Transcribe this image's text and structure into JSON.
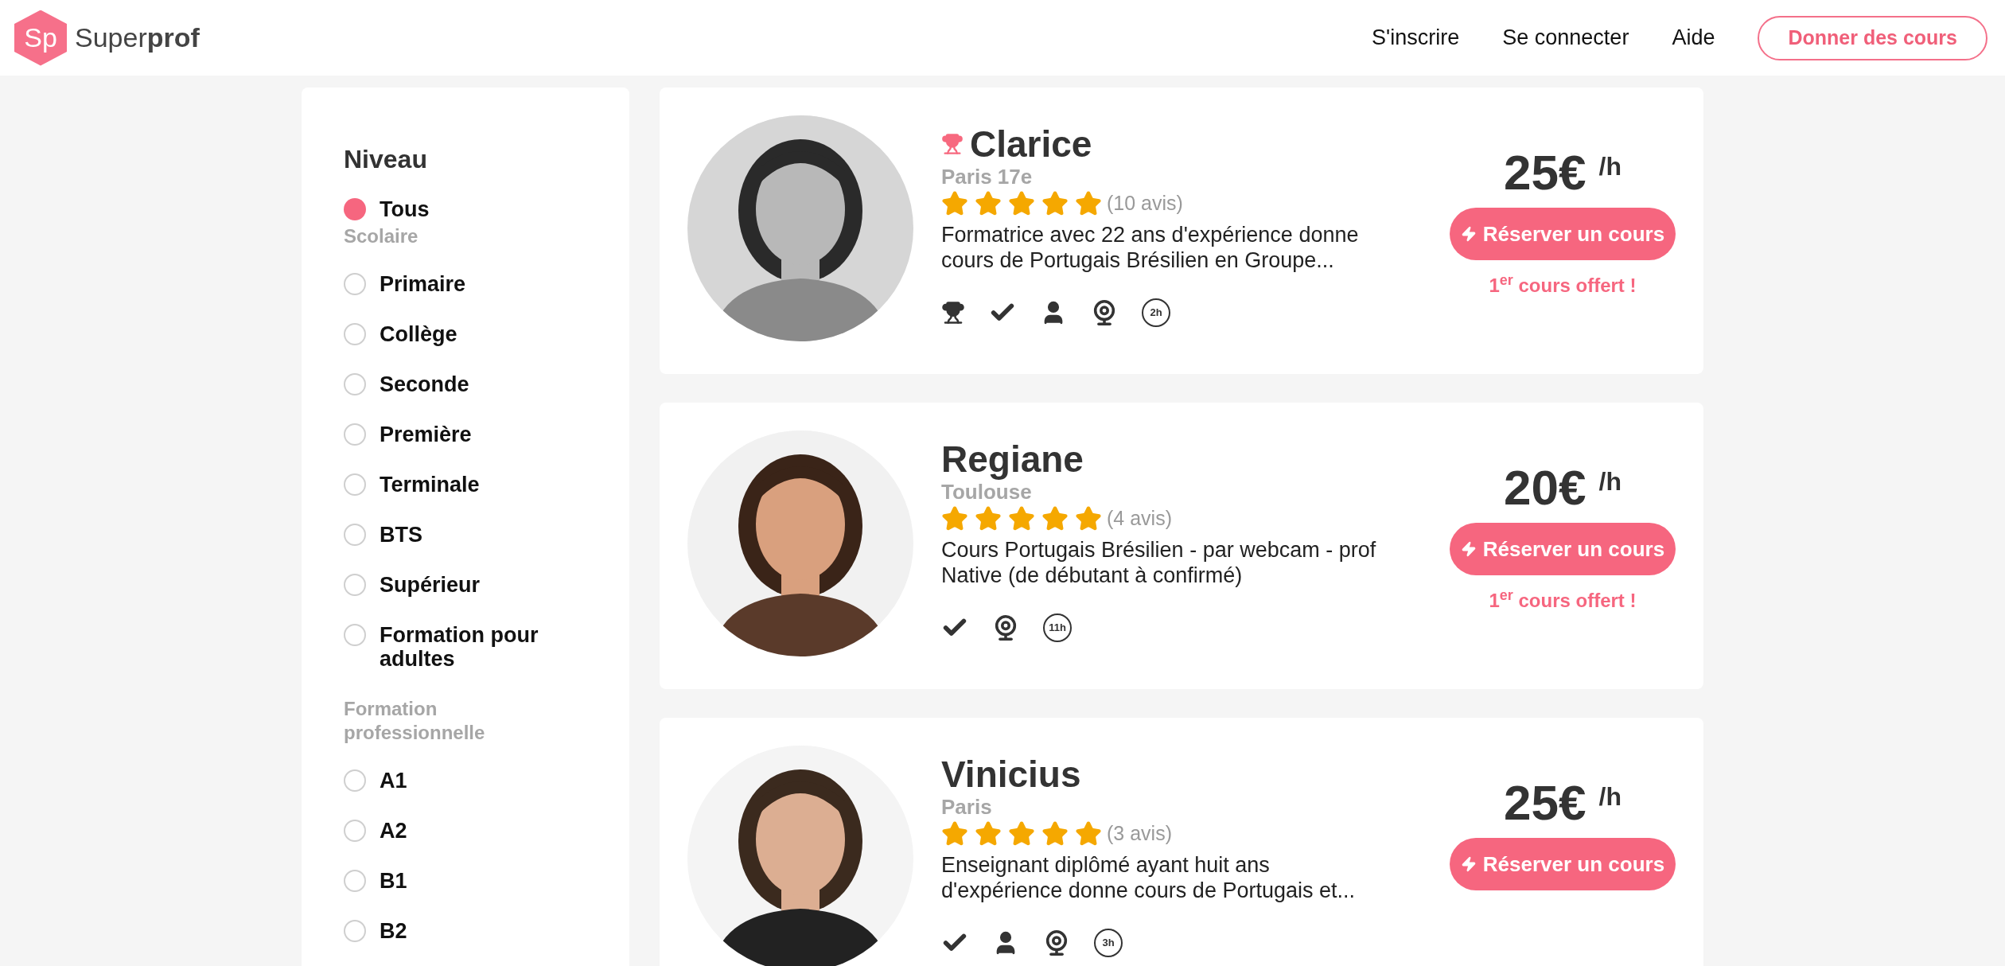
{
  "header": {
    "logo_mark": "Sp",
    "logo_text": "Super**prof**",
    "nav": [
      "S'inscrire",
      "Se connecter",
      "Aide"
    ],
    "cta": "Donner des cours"
  },
  "sidebar": {
    "title": "Niveau",
    "items": [
      {
        "kind": "option",
        "label": "Tous",
        "selected": true
      },
      {
        "kind": "group",
        "label": "Scolaire"
      },
      {
        "kind": "option",
        "label": "Primaire",
        "selected": false
      },
      {
        "kind": "option",
        "label": "Collège",
        "selected": false
      },
      {
        "kind": "option",
        "label": "Seconde",
        "selected": false
      },
      {
        "kind": "option",
        "label": "Première",
        "selected": false
      },
      {
        "kind": "option",
        "label": "Terminale",
        "selected": false
      },
      {
        "kind": "option",
        "label": "BTS",
        "selected": false
      },
      {
        "kind": "option",
        "label": "Supérieur",
        "selected": false
      },
      {
        "kind": "option",
        "label": "Formation pour adultes",
        "selected": false
      },
      {
        "kind": "group",
        "label": "Formation professionnelle"
      },
      {
        "kind": "option",
        "label": "A1",
        "selected": false
      },
      {
        "kind": "option",
        "label": "A2",
        "selected": false
      },
      {
        "kind": "option",
        "label": "B1",
        "selected": false
      },
      {
        "kind": "option",
        "label": "B2",
        "selected": false
      }
    ]
  },
  "tutors": [
    {
      "name": "Clarice",
      "trophy": true,
      "location": "Paris 17e",
      "stars": 5,
      "reviews": "(10 avis)",
      "description": "Formatrice avec 22 ans d'expérience donne cours de Portugais Brésilien en Groupe...",
      "features": [
        {
          "kind": "trophy"
        },
        {
          "kind": "check"
        },
        {
          "kind": "person"
        },
        {
          "kind": "webcam"
        },
        {
          "kind": "hours",
          "text": "2h"
        }
      ],
      "photo": {
        "kind": "picture"
      },
      "price": "25€",
      "unit": "/h",
      "button": "Réserver un cours",
      "offer": "1$^{er}$ cours offert !"
    },
    {
      "name": "Regiane",
      "trophy": false,
      "location": "Toulouse",
      "stars": 5,
      "reviews": "(4 avis)",
      "description": "Cours Portugais Brésilien - par webcam - prof Native (de débutant à confirmé)",
      "features": [
        {
          "kind": "check"
        },
        {
          "kind": "webcam"
        },
        {
          "kind": "hours",
          "text": "11h"
        }
      ],
      "photo": {
        "kind": "picture"
      },
      "price": "20€",
      "unit": "/h",
      "button": "Réserver un cours",
      "offer": "1$^{er}$ cours offert !"
    },
    {
      "name": "Vinicius",
      "trophy": false,
      "location": "Paris",
      "stars": 5,
      "reviews": "(3 avis)",
      "description": "Enseignant diplômé ayant huit ans d'expérience donne cours de Portugais et...",
      "features": [
        {
          "kind": "check"
        },
        {
          "kind": "person"
        },
        {
          "kind": "webcam"
        },
        {
          "kind": "hours",
          "text": "3h"
        }
      ],
      "photo": {
        "kind": "picture"
      },
      "price": "25€",
      "unit": "/h",
      "button": "Réserver un cours"
    }
  ]
}
